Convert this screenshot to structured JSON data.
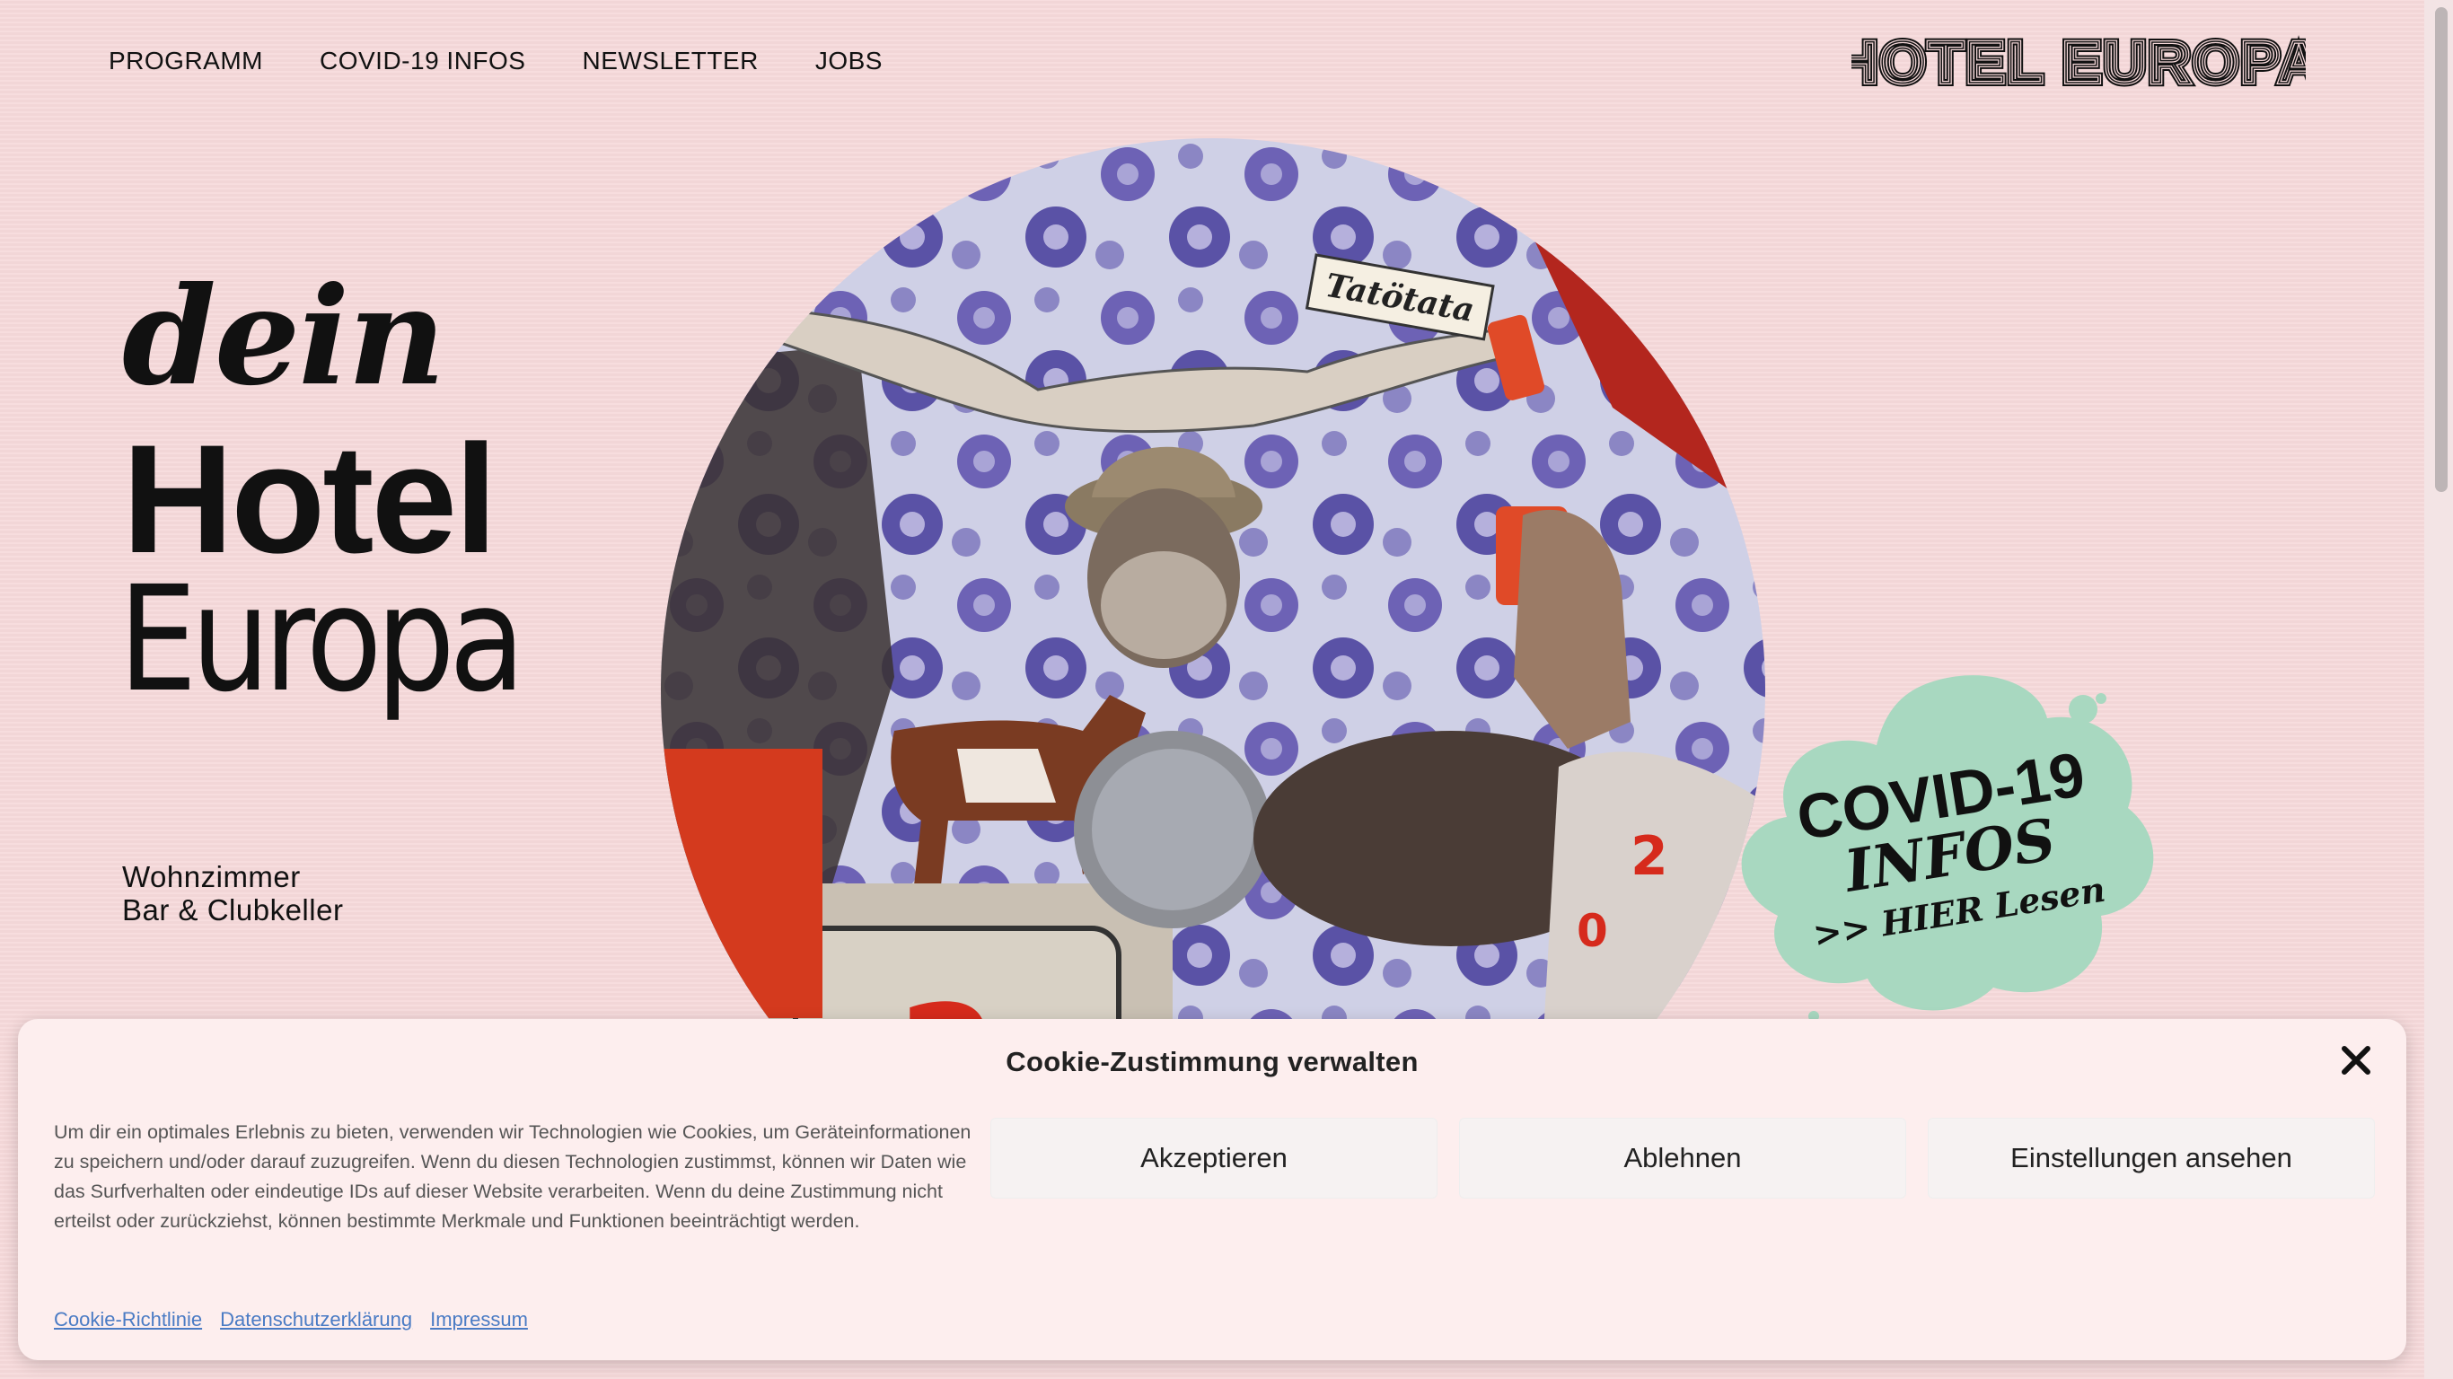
{
  "nav": {
    "items": [
      {
        "label": "PROGRAMM"
      },
      {
        "label": "COVID-19 INFOS"
      },
      {
        "label": "NEWSLETTER"
      },
      {
        "label": "JOBS"
      }
    ]
  },
  "logo": {
    "text": "HOTEL EUROPA"
  },
  "hero": {
    "line1": "dein",
    "line2": "Hotel",
    "line3": "Europa",
    "sub1": "Wohnzimmer",
    "sub2": "Bar & Clubkeller"
  },
  "collage": {
    "sign_text": "Tatötata"
  },
  "covid_badge": {
    "line1": "COVID-19",
    "line2": "INFOS",
    "line3": ">> HIER Lesen",
    "color": "#a8d8c0"
  },
  "cookie": {
    "title": "Cookie-Zustimmung verwalten",
    "text": "Um dir ein optimales Erlebnis zu bieten, verwenden wir Technologien wie Cookies, um Geräteinformationen zu speichern und/oder darauf zuzugreifen. Wenn du diesen Technologien zustimmst, können wir Daten wie das Surfverhalten oder eindeutige IDs auf dieser Website verarbeiten. Wenn du deine Zustimmung nicht erteilst oder zurückziehst, können bestimmte Merkmale und Funktionen beeinträchtigt werden.",
    "buttons": {
      "accept": "Akzeptieren",
      "decline": "Ablehnen",
      "settings": "Einstellungen ansehen"
    },
    "links": {
      "policy": "Cookie-Richtlinie",
      "privacy": "Datenschutzerklärung",
      "imprint": "Impressum"
    }
  },
  "colors": {
    "background": "#f6d9da",
    "accent_mint": "#a8d8c0",
    "link": "#4a7bc4"
  }
}
